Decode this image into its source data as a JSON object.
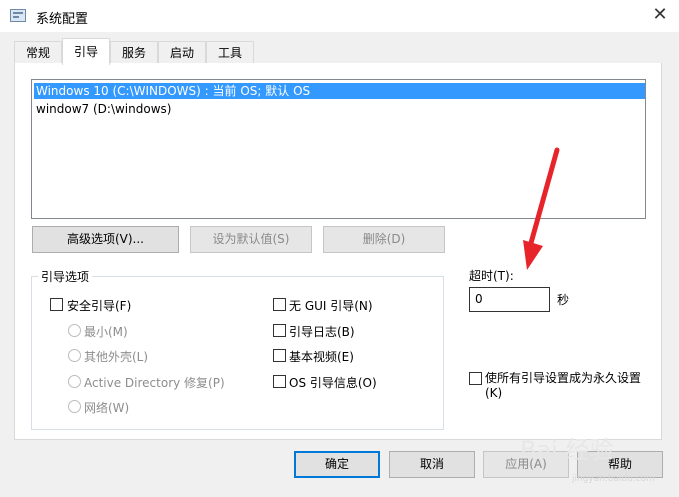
{
  "window": {
    "title": "系统配置",
    "close_glyph": "✕"
  },
  "tabs": [
    {
      "label": "常规"
    },
    {
      "label": "引导"
    },
    {
      "label": "服务"
    },
    {
      "label": "启动"
    },
    {
      "label": "工具"
    }
  ],
  "os_list": [
    {
      "label": "Windows 10 (C:\\WINDOWS) : 当前 OS; 默认 OS",
      "selected": true
    },
    {
      "label": "window7 (D:\\windows)",
      "selected": false
    }
  ],
  "actions": {
    "advanced": "高级选项(V)...",
    "set_default": "设为默认值(S)",
    "delete": "删除(D)"
  },
  "boot_options": {
    "title": "引导选项",
    "safe_boot": "安全引导(F)",
    "minimal": "最小(M)",
    "alternate_shell": "其他外壳(L)",
    "ad_repair": "Active Directory 修复(P)",
    "network": "网络(W)",
    "no_gui": "无 GUI 引导(N)",
    "boot_log": "引导日志(B)",
    "base_video": "基本视频(E)",
    "os_info": "OS 引导信息(O)"
  },
  "timeout": {
    "label": "超时(T):",
    "value": "0",
    "unit": "秒"
  },
  "permanent": {
    "line1": "使所有引导设置成为永久设置",
    "line2": "(K)"
  },
  "footer": {
    "ok": "确定",
    "cancel": "取消",
    "apply": "应用(A)",
    "help": "帮助"
  },
  "watermark": {
    "text": "Bai 经验",
    "sub": "jingyan.baidu.com"
  },
  "colors": {
    "selection": "#3399ff",
    "accent": "#0078d7",
    "arrow": "#e8242b"
  }
}
